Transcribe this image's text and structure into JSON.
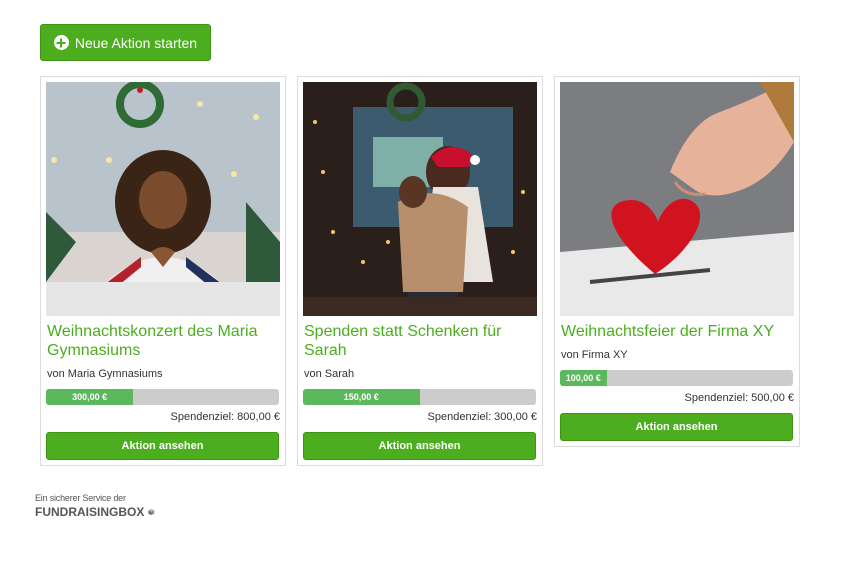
{
  "header": {
    "start_button_label": "Neue Aktion starten"
  },
  "cards": [
    {
      "title": "Weihnachtskonzert des Maria Gymnasiums",
      "by": "von Maria Gymnasiums",
      "raised": "300,00 €",
      "progress_percent": 37.5,
      "goal": "Spendenziel: 800,00 €",
      "button_label": "Aktion ansehen"
    },
    {
      "title": "Spenden statt Schenken für Sarah",
      "by": "von Sarah",
      "raised": "150,00 €",
      "progress_percent": 50,
      "goal": "Spendenziel: 300,00 €",
      "button_label": "Aktion ansehen"
    },
    {
      "title": "Weihnachtsfeier der Firma XY",
      "by": "von Firma XY",
      "raised": "100,00 €",
      "progress_percent": 20,
      "goal": "Spendenziel: 500,00 €",
      "button_label": "Aktion ansehen"
    }
  ],
  "footer": {
    "service_text": "Ein sicherer Service der",
    "brand_text": "FUNDRAISINGBOX"
  },
  "colors": {
    "accent": "#4cae1e",
    "progress": "#5cb85c",
    "track": "#cccccc"
  }
}
